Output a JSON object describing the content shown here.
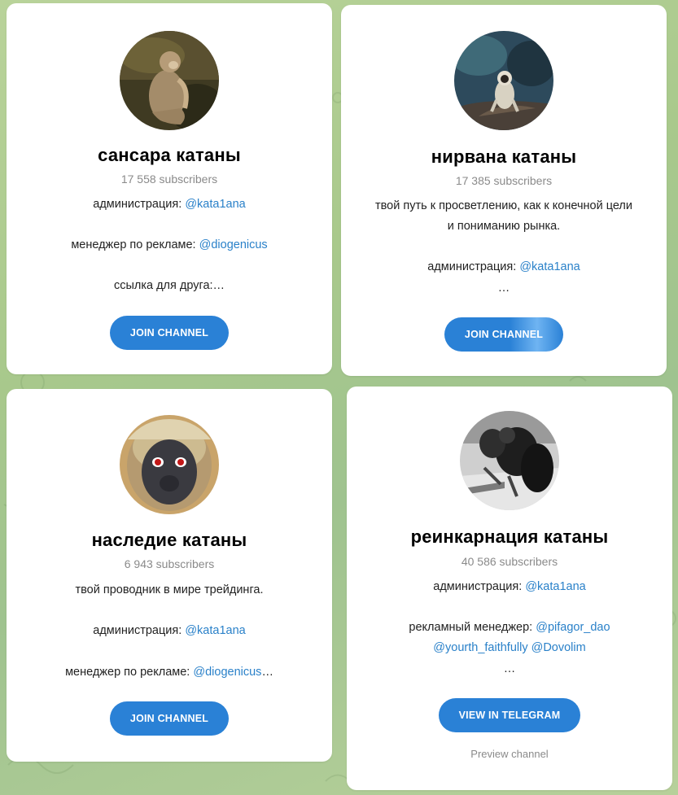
{
  "accent": "#2a81d6",
  "cards": [
    {
      "title": "сансара катаны",
      "subscribers": "17 558 subscribers",
      "lines": [
        {
          "text": "администрация: ",
          "link": "@kata1ana"
        },
        {
          "text": "менеджер по рекламе: ",
          "link": "@diogenicus"
        },
        {
          "text": "ссылка для друга:…",
          "link": ""
        }
      ],
      "button": "JOIN CHANNEL",
      "avatar_icon": "monkey-sitting-photo"
    },
    {
      "title": "нирвана катаны",
      "subscribers": "17 385 subscribers",
      "lines": [
        {
          "text": "твой путь к просветлению, как к конечной цели",
          "link": ""
        },
        {
          "text": "и пониманию рынка.",
          "link": ""
        },
        {
          "text": "администрация: ",
          "link": "@kata1ana"
        },
        {
          "text": "…",
          "link": ""
        }
      ],
      "button": "JOIN CHANNEL",
      "avatar_icon": "langur-on-rock-photo"
    },
    {
      "title": "наследие катаны",
      "subscribers": "6 943 subscribers",
      "lines": [
        {
          "text": "твой проводник в мире трейдинга.",
          "link": ""
        },
        {
          "text": "администрация: ",
          "link": "@kata1ana"
        },
        {
          "text": "менеджер по рекламе: ",
          "link": "@diogenicus",
          "suffix": "…"
        }
      ],
      "button": "JOIN CHANNEL",
      "avatar_icon": "monkey-face-photo"
    },
    {
      "title": "реинкарнация катаны",
      "subscribers": "40 586 subscribers",
      "lines": [
        {
          "text": "администрация: ",
          "link": "@kata1ana"
        },
        {
          "text": "рекламный менеджер: ",
          "link": "@pifagor_dao"
        },
        {
          "text": "",
          "link": "@yourth_faithfully @Dovolim"
        },
        {
          "text": "…",
          "link": ""
        }
      ],
      "button": "VIEW IN TELEGRAM",
      "preview": "Preview channel",
      "avatar_icon": "chimps-bw-photo"
    }
  ]
}
